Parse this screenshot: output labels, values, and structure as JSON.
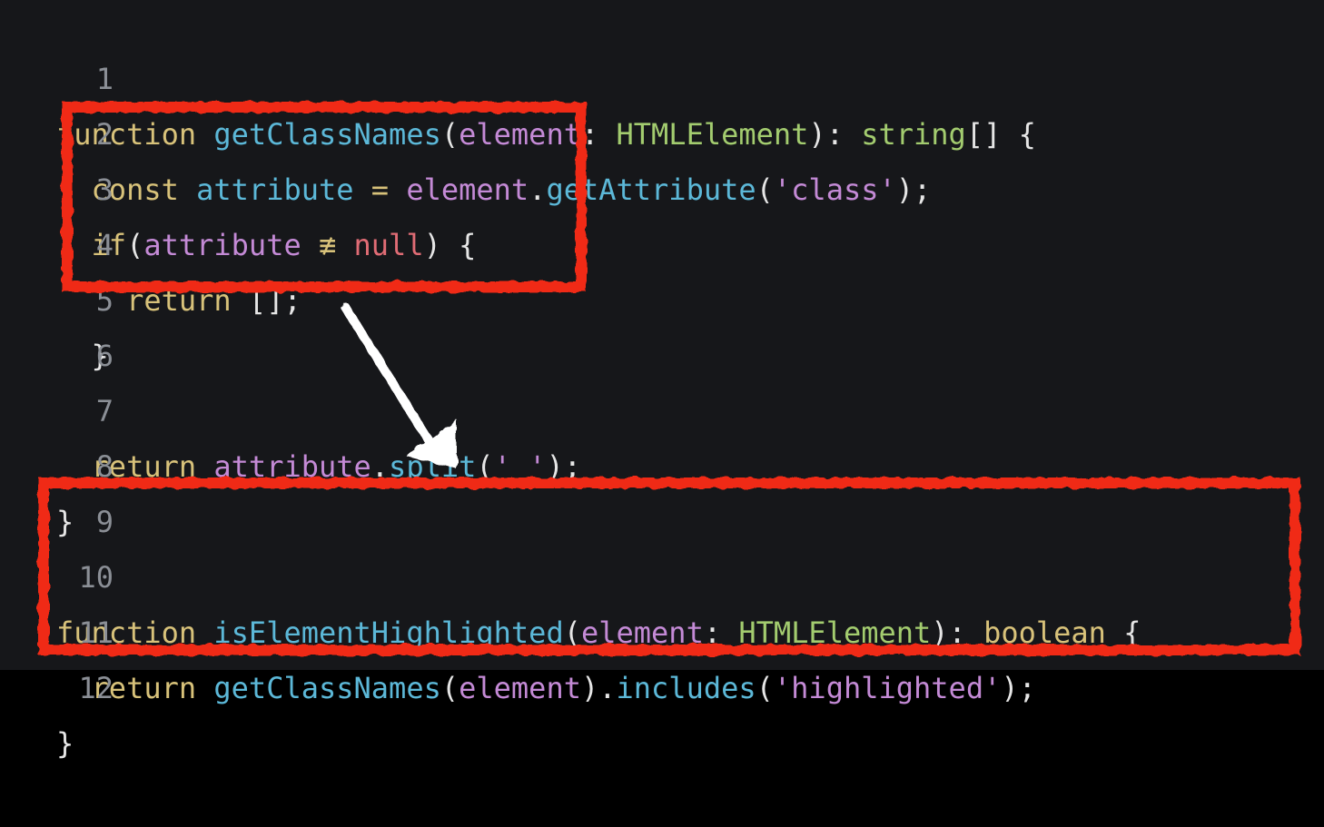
{
  "editor": {
    "lines": [
      {
        "number": "1",
        "code": "function getClassNames(element: HTMLElement): string[] {"
      },
      {
        "number": "2",
        "code": "  const attribute = element.getAttribute('class');"
      },
      {
        "number": "3",
        "code": "  if(attribute ≢ null) {"
      },
      {
        "number": "4",
        "code": "    return [];"
      },
      {
        "number": "5",
        "code": "  }"
      },
      {
        "number": "6",
        "code": ""
      },
      {
        "number": "7",
        "code": "  return attribute.split(' ');"
      },
      {
        "number": "8",
        "code": "}"
      },
      {
        "number": "9",
        "code": ""
      },
      {
        "number": "10",
        "code": "function isElementHighlighted(element: HTMLElement): boolean {"
      },
      {
        "number": "11",
        "code": "  return getClassNames(element).includes('highlighted');"
      },
      {
        "number": "12",
        "code": "}"
      }
    ]
  },
  "annotations": {
    "box_color": "#f02a18",
    "arrow_color": "#ffffff",
    "boxes": [
      "if-block-highlight",
      "function-highlight"
    ]
  },
  "colors": {
    "background": "#16171a",
    "keyword": "#d8c27a",
    "function_name": "#5cb8d8",
    "identifier": "#c48ad6",
    "type": "#a3cc6f",
    "null": "#e06c75",
    "line_number": "#8b8f96"
  }
}
